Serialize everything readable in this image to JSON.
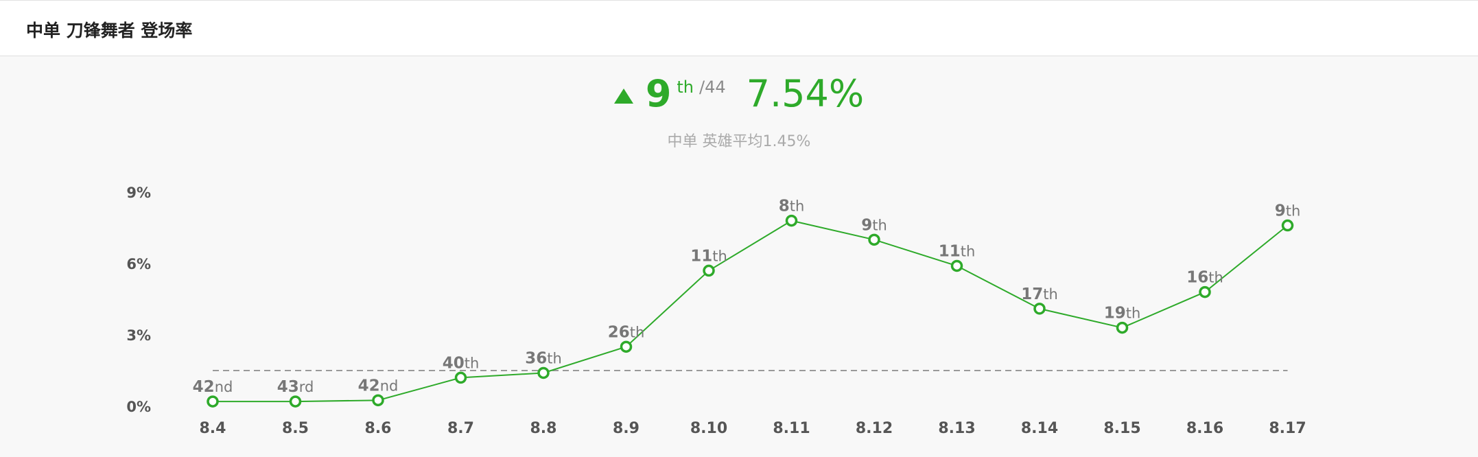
{
  "header": {
    "title": "中单 刀锋舞者 登场率"
  },
  "summary": {
    "trend_icon": "triangle-up-icon",
    "rank": "9",
    "rank_suffix": "th",
    "rank_total": "/44",
    "rate": "7.54%",
    "average_text": "中单 英雄平均1.45%"
  },
  "colors": {
    "accent": "#2eaa2a",
    "muted": "#8a8a8a",
    "average_line": "#999999"
  },
  "chart_data": {
    "type": "line",
    "title": "",
    "xlabel": "",
    "ylabel": "",
    "x": [
      "8.4",
      "8.5",
      "8.6",
      "8.7",
      "8.8",
      "8.9",
      "8.10",
      "8.11",
      "8.12",
      "8.13",
      "8.14",
      "8.15",
      "8.16",
      "8.17"
    ],
    "yticks": [
      "0%",
      "3%",
      "6%",
      "9%"
    ],
    "ylim": [
      0,
      9
    ],
    "series": [
      {
        "values": [
          0.2,
          0.2,
          0.25,
          1.2,
          1.4,
          2.5,
          5.7,
          7.8,
          7.0,
          5.9,
          4.1,
          3.3,
          4.8,
          7.6
        ],
        "point_labels": [
          [
            "42",
            "nd"
          ],
          [
            "43",
            "rd"
          ],
          [
            "42",
            "nd"
          ],
          [
            "40",
            "th"
          ],
          [
            "36",
            "th"
          ],
          [
            "26",
            "th"
          ],
          [
            "11",
            "th"
          ],
          [
            "8",
            "th"
          ],
          [
            "9",
            "th"
          ],
          [
            "11",
            "th"
          ],
          [
            "17",
            "th"
          ],
          [
            "19",
            "th"
          ],
          [
            "16",
            "th"
          ],
          [
            "9",
            "th"
          ]
        ]
      }
    ],
    "average_value": 1.5,
    "grid": false,
    "legend": "none"
  }
}
